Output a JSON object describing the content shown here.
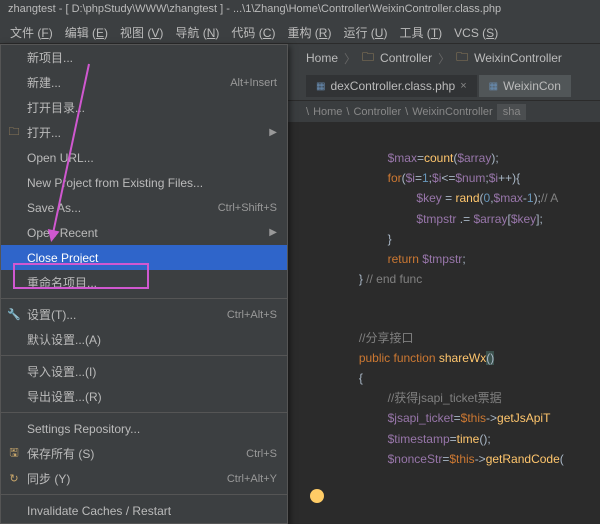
{
  "title_bar": "zhangtest - [ D:\\phpStudy\\WWW\\zhangtest ] - ...\\1\\Zhang\\Home\\Controller\\WeixinController.class.php",
  "menus": [
    {
      "label": "文件",
      "u": "F"
    },
    {
      "label": "编辑",
      "u": "E"
    },
    {
      "label": "视图",
      "u": "V"
    },
    {
      "label": "导航",
      "u": "N"
    },
    {
      "label": "代码",
      "u": "C"
    },
    {
      "label": "重构",
      "u": "R"
    },
    {
      "label": "运行",
      "u": "U"
    },
    {
      "label": "工具",
      "u": "T"
    },
    {
      "label": "VCS",
      "u": "S"
    }
  ],
  "breadcrumb": {
    "items": [
      "Home",
      "Controller",
      "WeixinController"
    ]
  },
  "tabs": [
    {
      "label": "dexController.class.php",
      "active": false
    },
    {
      "label": "WeixinCon",
      "active": true
    }
  ],
  "mini_breadcrumb": {
    "segments": [
      "Home",
      "Controller",
      "WeixinController"
    ],
    "trailing": "sha"
  },
  "dropdown": [
    {
      "type": "item",
      "label": "新项目..."
    },
    {
      "type": "item",
      "label": "新建...",
      "shortcut": "Alt+Insert"
    },
    {
      "type": "item",
      "label": "打开目录..."
    },
    {
      "type": "item",
      "label": "打开...",
      "icon": "folder",
      "arrow": true
    },
    {
      "type": "item",
      "label": "Open URL..."
    },
    {
      "type": "item",
      "label": "New Project from Existing Files..."
    },
    {
      "type": "item",
      "label": "Save As...",
      "shortcut": "Ctrl+Shift+S"
    },
    {
      "type": "item",
      "label": "Open Recent",
      "arrow": true
    },
    {
      "type": "item",
      "label": "Close Project",
      "highlighted": true
    },
    {
      "type": "item",
      "label": "重命名项目..."
    },
    {
      "type": "sep"
    },
    {
      "type": "item",
      "label": "设置(T)...",
      "icon": "gear",
      "shortcut": "Ctrl+Alt+S"
    },
    {
      "type": "item",
      "label": "默认设置...(A)"
    },
    {
      "type": "sep"
    },
    {
      "type": "item",
      "label": "导入设置...(I)"
    },
    {
      "type": "item",
      "label": "导出设置...(R)"
    },
    {
      "type": "sep"
    },
    {
      "type": "item",
      "label": "Settings Repository..."
    },
    {
      "type": "item",
      "label": "保存所有 (S)",
      "icon": "save",
      "shortcut": "Ctrl+S"
    },
    {
      "type": "item",
      "label": "同步 (Y)",
      "icon": "sync",
      "shortcut": "Ctrl+Alt+Y"
    },
    {
      "type": "sep"
    },
    {
      "type": "item",
      "label": "Invalidate Caches / Restart"
    }
  ],
  "code": {
    "l1a": "$max",
    "l1b": "=",
    "l1c": "count",
    "l1d": "(",
    "l1e": "$array",
    "l1f": ");",
    "l2a": "for",
    "l2b": "(",
    "l2c": "$i",
    "l2d": "=",
    "l2e": "1",
    "l2f": ";",
    "l2g": "$i",
    "l2h": "<=",
    "l2i": "$num",
    "l2j": ";",
    "l2k": "$i",
    "l2l": "++){",
    "l3a": "$key",
    "l3b": " = ",
    "l3c": "rand",
    "l3d": "(",
    "l3e": "0",
    "l3f": ",",
    "l3g": "$max",
    "l3h": "-",
    "l3i": "1",
    "l3j": ");",
    "l3k": "// A",
    "l4a": "$tmpstr",
    "l4b": " .= ",
    "l4c": "$array",
    "l4d": "[",
    "l4e": "$key",
    "l4f": "];",
    "l5a": "}",
    "l6a": "return ",
    "l6b": "$tmpstr",
    "l6c": ";",
    "l7a": "} ",
    "l7b": "// end func",
    "l8a": "//分享接口",
    "l9a": "public ",
    "l9b": "function ",
    "l9c": "shareWx",
    "l9d": "()",
    "l10a": "{",
    "l11a": "//获得jsapi_ticket票据",
    "l12a": "$jsapi_ticket",
    "l12b": "=",
    "l12c": "$this",
    "l12d": "->",
    "l12e": "getJsApiT",
    "l13a": "$timestamp",
    "l13b": "=",
    "l13c": "time",
    "l13d": "();",
    "l14a": "$nonceStr",
    "l14b": "=",
    "l14c": "$this",
    "l14d": "->",
    "l14e": "getRandCode",
    "l14f": "("
  }
}
